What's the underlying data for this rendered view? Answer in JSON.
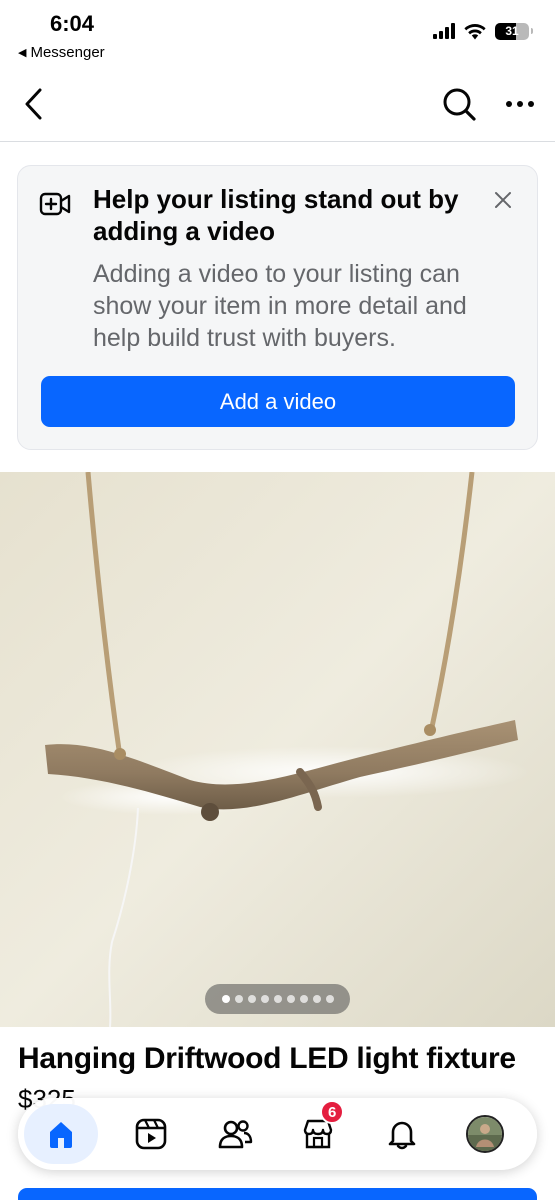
{
  "status_bar": {
    "time": "6:04",
    "back_app_label": "Messenger",
    "battery_level": "31"
  },
  "nav": {
    "back_icon": "chevron-left-icon",
    "search_icon": "search-icon",
    "more_icon": "more-horizontal-icon"
  },
  "promo": {
    "icon": "video-add-icon",
    "title": "Help your listing stand out by adding a video",
    "body": "Adding a video to your listing can show your item in more detail and help build trust with buyers.",
    "button_label": "Add a video",
    "close_icon": "close-icon",
    "accent_color": "#0866ff"
  },
  "listing": {
    "photo_count": 9,
    "active_photo": 1,
    "title": "Hanging Driftwood LED light fixture",
    "price": "$325"
  },
  "tab_bar": {
    "items": [
      {
        "name": "home",
        "icon": "home-icon",
        "active": true
      },
      {
        "name": "video",
        "icon": "video-feed-icon"
      },
      {
        "name": "friends",
        "icon": "friends-icon"
      },
      {
        "name": "marketplace",
        "icon": "marketplace-icon",
        "badge": "6"
      },
      {
        "name": "notifications",
        "icon": "bell-icon"
      },
      {
        "name": "profile",
        "icon": "avatar-icon"
      }
    ]
  }
}
